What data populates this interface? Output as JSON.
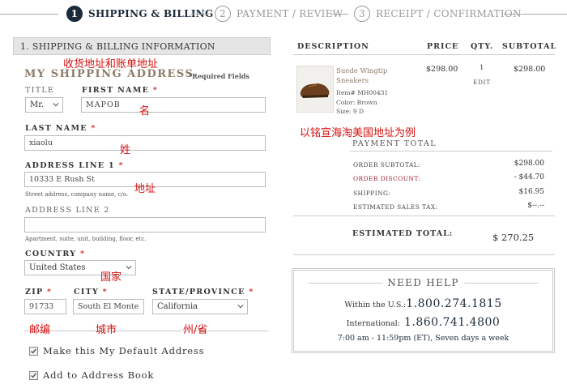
{
  "steps": [
    {
      "num": "1",
      "label": "SHIPPING & BILLING",
      "active": true
    },
    {
      "num": "2",
      "label": "PAYMENT / REVIEW",
      "active": false
    },
    {
      "num": "3",
      "label": "RECEIPT / CONFIRMATION",
      "active": false
    }
  ],
  "left": {
    "section_title": "1. SHIPPING & BILLING INFORMATION",
    "heading": "MY SHIPPING ADDRESS",
    "required_note": "*Required Fields",
    "title_label": "TITLE",
    "title_value": "Mr.",
    "first_name_label": "FIRST NAME",
    "first_name_value": "MAPOB",
    "last_name_label": "LAST NAME",
    "last_name_value": "xiaolu",
    "address1_label": "ADDRESS LINE 1",
    "address1_value": "10333 E Rush St",
    "address1_hint": "Street address, company name, c/o.",
    "address2_label": "ADDRESS LINE 2",
    "address2_value": "",
    "address2_hint": "Apartment, suite, unit, building, floor, etc.",
    "country_label": "COUNTRY",
    "country_value": "United States",
    "zip_label": "ZIP",
    "zip_value": "91733",
    "city_label": "CITY",
    "city_value": "South El Monte",
    "state_label": "STATE/PROVINCE",
    "state_value": "California",
    "default_address_label": "Make this My Default Address",
    "address_book_label": "Add to Address Book",
    "required_star": "*"
  },
  "annotations": {
    "shipping_billing": "收货地址和账单地址",
    "first_name": "名",
    "last_name": "姓",
    "address": "地址",
    "country": "国家",
    "zip": "邮编",
    "city": "城市",
    "state": "州/省",
    "example": "以铭宣海淘美国地址为例"
  },
  "cart": {
    "headers": {
      "description": "DESCRIPTION",
      "price": "PRICE",
      "qty": "QTY.",
      "subtotal": "SUBTOTAL"
    },
    "item": {
      "name": "Suede Wingtip Sneakers",
      "item_no": "Item# MH00431",
      "color": "Color: Brown",
      "size": "Size: 9 D",
      "price": "$298.00",
      "qty": "1",
      "edit": "EDIT",
      "subtotal": "$298.00"
    }
  },
  "payment_total": {
    "title": "PAYMENT TOTAL",
    "rows": [
      {
        "label": "ORDER SUBTOTAL:",
        "value": "$298.00",
        "highlight": false
      },
      {
        "label": "ORDER DISCOUNT:",
        "value": "- $44.70",
        "highlight": true
      },
      {
        "label": "SHIPPING:",
        "value": "$16.95",
        "highlight": false
      },
      {
        "label": "ESTIMATED SALES TAX:",
        "value": "$--.--",
        "highlight": false
      }
    ],
    "estimated_label": "ESTIMATED TOTAL:",
    "estimated_value": "$ 270.25"
  },
  "help": {
    "title": "NEED HELP",
    "us_label": "Within the U.S.:",
    "us_phone": "1.800.274.1815",
    "intl_label": "International:",
    "intl_phone": "1.860.741.4800",
    "hours": "7:00 am - 11:59pm (ET), Seven days a week"
  },
  "colors": {
    "navy": "#1c2b3a",
    "heading_brown": "#8c7b67",
    "annotation_red": "#d81010",
    "discount_red": "#c0392b"
  }
}
